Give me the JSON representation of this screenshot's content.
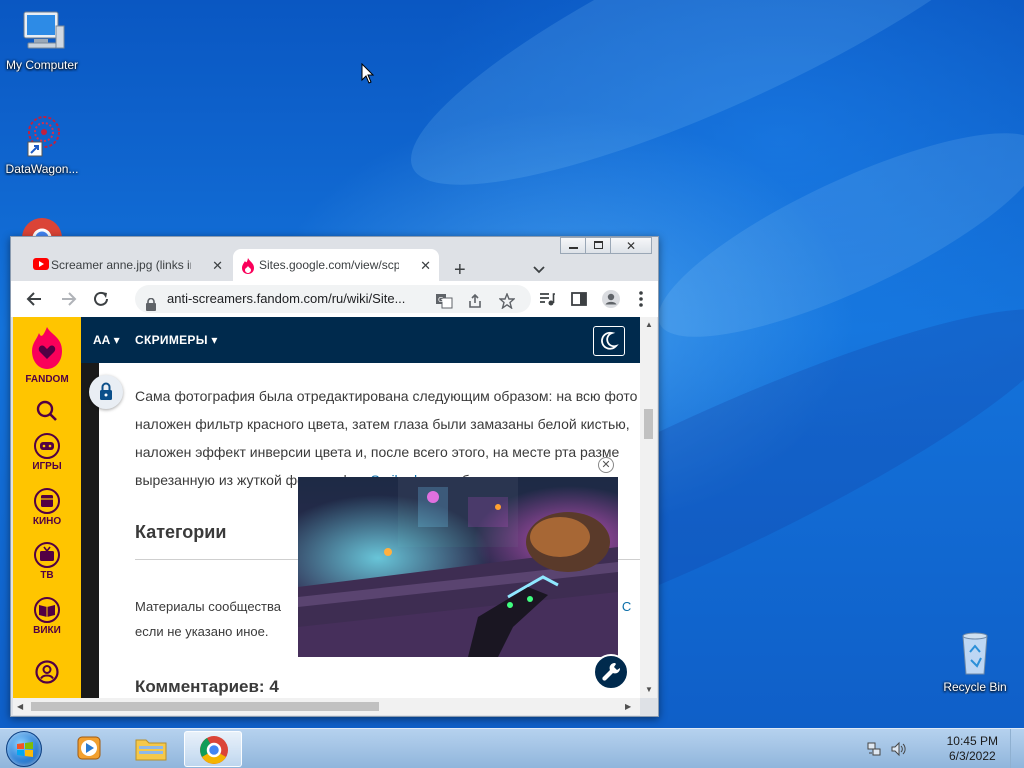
{
  "desktop": {
    "icons": [
      {
        "label": "My Computer"
      },
      {
        "label": "DataWagon..."
      },
      {
        "label": "Recycle Bin"
      }
    ]
  },
  "browser": {
    "tabs": [
      {
        "label": "Screamer anne.jpg (links in",
        "active": false
      },
      {
        "label": "Sites.google.com/view/scp",
        "active": true
      }
    ],
    "url": "anti-screamers.fandom.com/ru/wiki/Site..."
  },
  "fandom": {
    "brand": "FANDOM",
    "rail": [
      {
        "label": "ИГРЫ",
        "icon": "gamepad-icon"
      },
      {
        "label": "КИНО",
        "icon": "film-icon"
      },
      {
        "label": "ТВ",
        "icon": "tv-icon"
      },
      {
        "label": "ВИКИ",
        "icon": "book-icon"
      }
    ],
    "header_menu": "СКРИМЕРЫ",
    "header_logo": "АА"
  },
  "article": {
    "lines": [
      "Сама фотография была отредактирована следующим образом: на всю фото",
      "наложен фильтр красного цвета, затем глаза были замазаны белой кистью,",
      "наложен эффект инверсии цвета и, после всего этого, на месте рта разме",
      "вырезанную из жуткой фотографии"
    ],
    "link": "Smile.dog",
    "line4_end": " улыбку.",
    "categories_heading": "Категории",
    "license_line1": "Материалы сообщества",
    "license_line1_end": "и С",
    "license_line2": "если не указано иное.",
    "comments": "Комментариев: 4"
  },
  "taskbar": {
    "time": "10:45 PM",
    "date": "6/3/2022"
  },
  "colors": {
    "fandom_yellow": "#ffc500",
    "fandom_navy": "#002a4d",
    "fandom_purple": "#520044"
  }
}
